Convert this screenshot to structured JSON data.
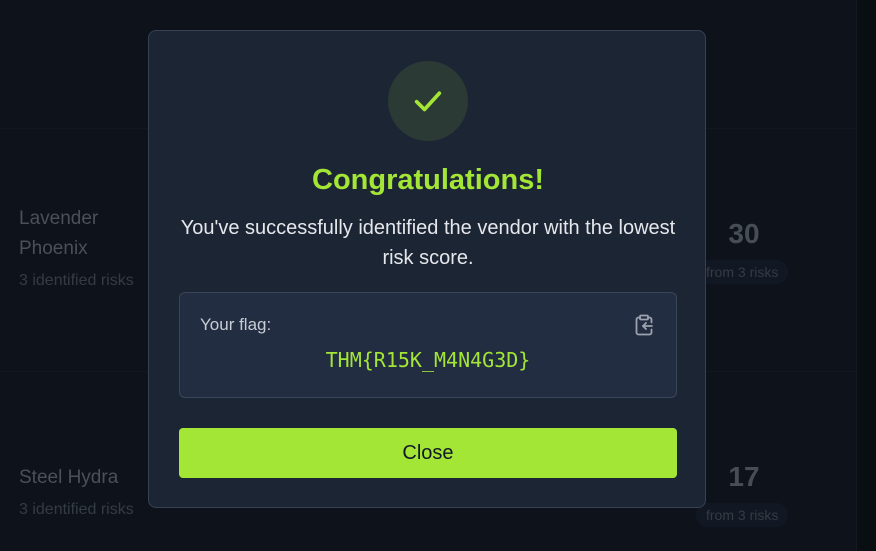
{
  "background": {
    "vendors": [
      {
        "name_line1": "Lavender",
        "name_line2": "Phoenix",
        "risks_label": "3 identified risks",
        "score": "30",
        "score_sub": "from 3 risks"
      },
      {
        "name_line1": "Steel Hydra",
        "name_line2": "",
        "risks_label": "3 identified risks",
        "score": "17",
        "score_sub": "from 3 risks"
      }
    ]
  },
  "modal": {
    "icon": "check-icon",
    "title": "Congratulations!",
    "message": "You've successfully identified the vendor with the lowest risk score.",
    "flag_label": "Your flag:",
    "flag_value": "THM{R15K_M4N4G3D}",
    "copy_icon": "clipboard-copy-icon",
    "close_label": "Close"
  },
  "colors": {
    "accent": "#a3e635",
    "modal_bg": "#1c2534",
    "page_bg": "#121824"
  }
}
